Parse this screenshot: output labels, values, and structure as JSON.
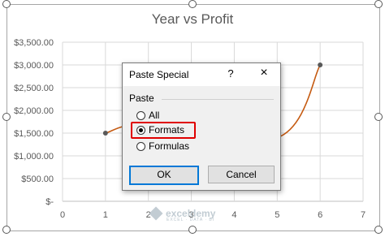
{
  "chart_data": {
    "type": "scatter",
    "title": "Year vs Profit",
    "x": [
      1,
      2,
      5,
      6
    ],
    "y": [
      1500,
      1700,
      1400,
      3000
    ],
    "xlim": [
      0,
      7
    ],
    "ylim": [
      0,
      3500
    ],
    "x_ticks": [
      "0",
      "1",
      "2",
      "3",
      "4",
      "5",
      "6",
      "7"
    ],
    "y_ticks": [
      "$-",
      "$500.00",
      "$1,000.00",
      "$1,500.00",
      "$2,000.00",
      "$2,500.00",
      "$3,000.00",
      "$3,500.00"
    ],
    "grid": true,
    "line_color": "#c55a11",
    "marker_color": "#595959"
  },
  "dialog": {
    "title": "Paste Special",
    "help": "?",
    "close": "×",
    "group_label": "Paste",
    "options": [
      {
        "label": "All",
        "checked": false
      },
      {
        "label": "Formats",
        "checked": true
      },
      {
        "label": "Formulas",
        "checked": false
      }
    ],
    "ok_label": "OK",
    "cancel_label": "Cancel"
  },
  "watermark": {
    "name": "exceldemy",
    "tagline": "EXCEL · DATA · BI"
  },
  "colors": {
    "highlight": "#e00000",
    "ok_border": "#0078d7"
  }
}
